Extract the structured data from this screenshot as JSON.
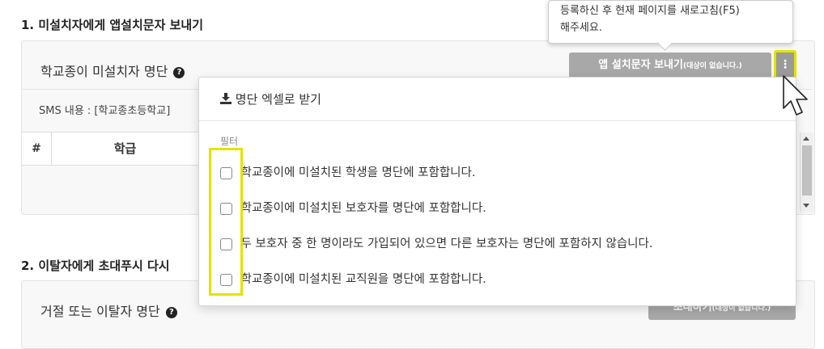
{
  "section1": {
    "title": "1. 미설치자에게 앱설치문자 보내기",
    "panel_title": "학교종이 미설치자 명단",
    "send_button": {
      "label": "앱 설치문자 보내기",
      "sub": "(대상이 없습니다.)"
    },
    "sms_content": "SMS 내용 : [학교종초등학교]",
    "table": {
      "columns": [
        "#",
        "학급"
      ]
    }
  },
  "tooltip": {
    "line1": "등록하신 후 현재 페이지를 새로고침(F5)",
    "line2": "해주세요."
  },
  "dropdown": {
    "download_label": "명단 엑셀로 받기",
    "filter_header": "필터",
    "filters": [
      "학교종이에 미설치된 학생을 명단에 포함합니다.",
      "학교종이에 미설치된 보호자를 명단에 포함합니다.",
      "두 보호자 중 한 명이라도 가입되어 있으면 다른 보호자는 명단에 포함하지 않습니다.",
      "학교종이에 미설치된 교직원을 명단에 포함합니다."
    ]
  },
  "section2": {
    "title": "2. 이탈자에게 초대푸시 다시",
    "panel_title": "거절 또는 이탈자 명단",
    "send_button": {
      "label": "초대하기",
      "sub": "(대상이 없습니다.)"
    }
  },
  "colors": {
    "highlight": "#e3e300",
    "button_gray": "#a8a8a8"
  },
  "icons": [
    "help-icon",
    "download-icon",
    "kebab-menu-icon",
    "cursor-pointer-icon"
  ]
}
